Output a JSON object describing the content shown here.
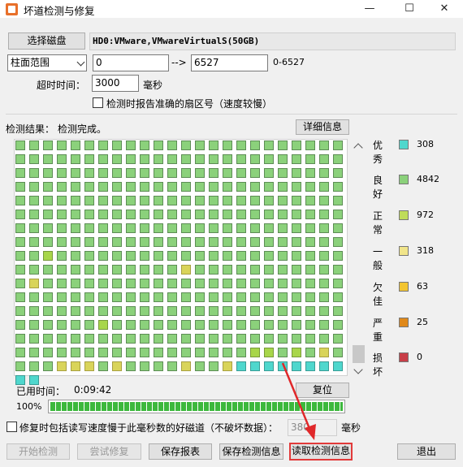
{
  "window": {
    "title": "坏道检测与修复",
    "minimize": "—",
    "maximize": "☐",
    "close": "✕"
  },
  "disk": {
    "select_label": "选择磁盘",
    "value": "HD0:VMware,VMwareVirtualS(50GB)"
  },
  "range": {
    "type_value": "柱面范围",
    "start": "0",
    "arrow": "-->",
    "end": "6527",
    "hint": "0-6527"
  },
  "timeout": {
    "label": "超时时间：",
    "value": "3000",
    "unit": "毫秒"
  },
  "report_sector": {
    "label": "检测时报告准确的扇区号（速度较慢）"
  },
  "result": {
    "label": "检测结果：",
    "status": "检测完成。",
    "detail_button": "详细信息"
  },
  "legend": [
    {
      "name": "优秀",
      "color": "#4fd7cd",
      "count": "308"
    },
    {
      "name": "良好",
      "color": "#8bd17b",
      "count": "4842"
    },
    {
      "name": "正常",
      "color": "#bfdc5a",
      "count": "972"
    },
    {
      "name": "一般",
      "color": "#f1e58a",
      "count": "318"
    },
    {
      "name": "欠佳",
      "color": "#f3c531",
      "count": "63"
    },
    {
      "name": "严重",
      "color": "#e0891a",
      "count": "25"
    },
    {
      "name": "损坏",
      "color": "#c83e48",
      "count": "0"
    }
  ],
  "elapsed": {
    "label": "已用时间：",
    "value": "0:09:42",
    "reset_button": "复位"
  },
  "progress": {
    "text": "100%",
    "fraction": 1.0
  },
  "repair_option": {
    "label": "修复时包括读写速度慢于此毫秒数的好磁道（不破坏数据）：",
    "value": "380",
    "unit": "毫秒"
  },
  "actions": {
    "start": "开始检测",
    "try_repair": "尝试修复",
    "save_report": "保存报表",
    "save_info": "保存检测信息",
    "read_info": "读取检测信息",
    "exit": "退出"
  }
}
